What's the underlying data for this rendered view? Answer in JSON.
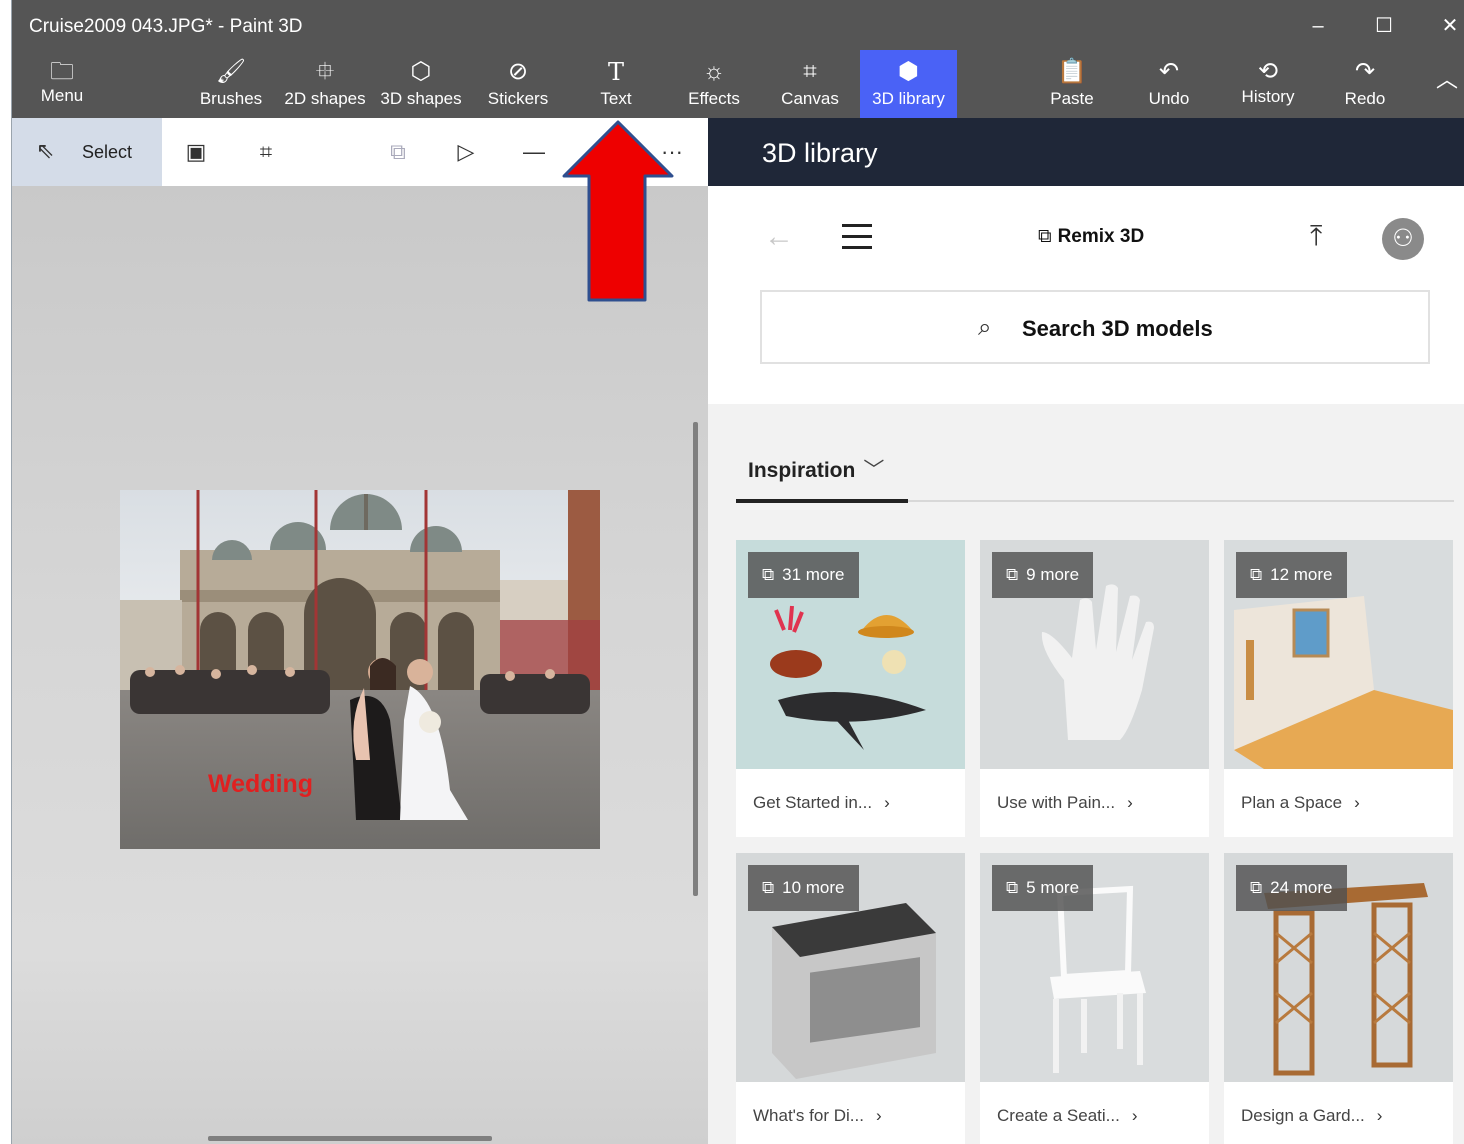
{
  "window": {
    "title": "Cruise2009 043.JPG* - Paint 3D",
    "controls": [
      "–",
      "☐",
      "✕"
    ]
  },
  "ribbon": {
    "items": [
      {
        "label": "Menu",
        "icon": "folder-icon",
        "glyph": "🗀"
      },
      {
        "label": "Brushes",
        "icon": "brush-icon",
        "glyph": "🖌"
      },
      {
        "label": "2D shapes",
        "icon": "2d-shapes-icon",
        "glyph": "⯐"
      },
      {
        "label": "3D shapes",
        "icon": "3d-shapes-icon",
        "glyph": "⬡"
      },
      {
        "label": "Stickers",
        "icon": "stickers-icon",
        "glyph": "⊘"
      },
      {
        "label": "Text",
        "icon": "text-icon",
        "glyph": "T"
      },
      {
        "label": "Effects",
        "icon": "effects-icon",
        "glyph": "☼"
      },
      {
        "label": "Canvas",
        "icon": "canvas-icon",
        "glyph": "⌗"
      },
      {
        "label": "3D library",
        "icon": "3d-library-icon",
        "glyph": "⬢"
      },
      {
        "label": "Paste",
        "icon": "paste-icon",
        "glyph": "📋"
      },
      {
        "label": "Undo",
        "icon": "undo-icon",
        "glyph": "↶"
      },
      {
        "label": "History",
        "icon": "history-icon",
        "glyph": "⟲"
      },
      {
        "label": "Redo",
        "icon": "redo-icon",
        "glyph": "↷"
      }
    ],
    "active": "3D library",
    "active_color": "#4a62f6",
    "background": "#555555"
  },
  "tools": {
    "select_label": "Select",
    "more": "···"
  },
  "canvas": {
    "photo_text": "Wedding"
  },
  "library": {
    "title": "3D library",
    "brand": "Remix 3D",
    "search_placeholder": "Search 3D models",
    "section": "Inspiration",
    "header_color": "#1f2738",
    "cards": [
      {
        "badge": "31 more",
        "caption": "Get Started in..."
      },
      {
        "badge": "9 more",
        "caption": "Use with Pain..."
      },
      {
        "badge": "12 more",
        "caption": "Plan a Space"
      },
      {
        "badge": "10 more",
        "caption": "What's for Di..."
      },
      {
        "badge": "5 more",
        "caption": "Create a Seati..."
      },
      {
        "badge": "24 more",
        "caption": "Design a Gard..."
      }
    ]
  },
  "annotation": {
    "arrow_color": "#ee0000"
  }
}
